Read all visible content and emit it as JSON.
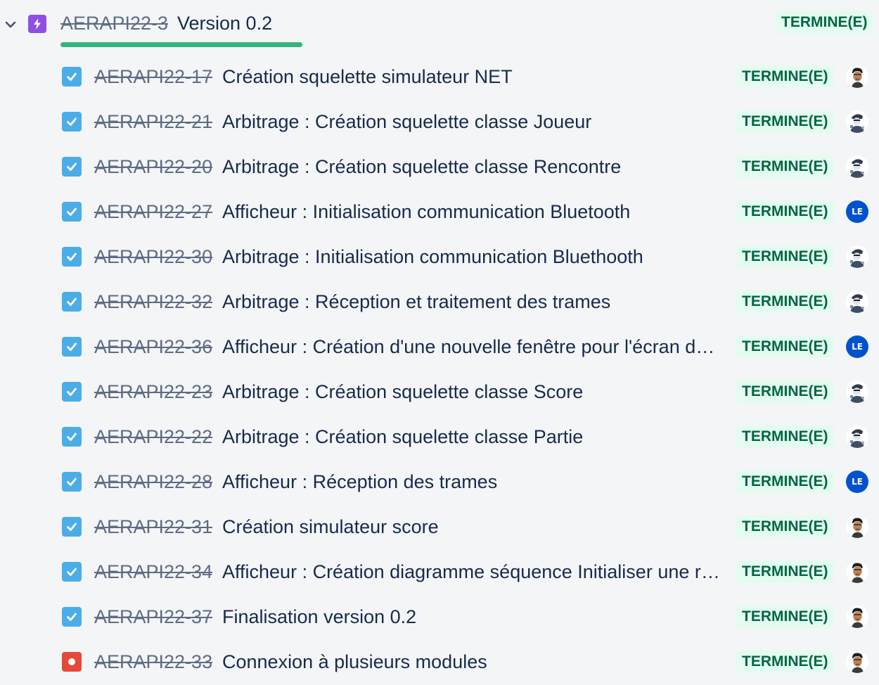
{
  "epic": {
    "key": "AERAPI22-3",
    "title": "Version 0.2",
    "status": "TERMINE(E)",
    "progress": 1.0,
    "icon": "epic-lightning-icon",
    "expand_icon": "chevron-down-icon",
    "colors": {
      "epic": "#904ee2",
      "progress": "#36b37e",
      "status_bg": "#e3fcef",
      "status_text": "#006644"
    }
  },
  "issue_types": {
    "task": {
      "icon": "checkbox-task-icon",
      "color": "#4bade8"
    },
    "bug": {
      "icon": "bug-dot-icon",
      "color": "#e5493a"
    }
  },
  "issues": [
    {
      "key": "AERAPI22-17",
      "summary": "Création squelette simulateur NET",
      "status": "TERMINE(E)",
      "type": "task",
      "assignee": {
        "kind": "photo-a",
        "icon": "user-avatar-portrait-icon"
      }
    },
    {
      "key": "AERAPI22-21",
      "summary": "Arbitrage : Création squelette classe Joueur",
      "status": "TERMINE(E)",
      "type": "task",
      "assignee": {
        "kind": "photo-b",
        "icon": "user-avatar-hacker-icon"
      }
    },
    {
      "key": "AERAPI22-20",
      "summary": "Arbitrage : Création squelette classe Rencontre",
      "status": "TERMINE(E)",
      "type": "task",
      "assignee": {
        "kind": "photo-b",
        "icon": "user-avatar-hacker-icon"
      }
    },
    {
      "key": "AERAPI22-27",
      "summary": "Afficheur : Initialisation communication Bluetooth",
      "status": "TERMINE(E)",
      "type": "task",
      "assignee": {
        "kind": "initials",
        "initials": "LE",
        "icon": "user-avatar-initials-icon"
      }
    },
    {
      "key": "AERAPI22-30",
      "summary": "Arbitrage : Initialisation communication Bluethooth",
      "status": "TERMINE(E)",
      "type": "task",
      "assignee": {
        "kind": "photo-b",
        "icon": "user-avatar-hacker-icon"
      }
    },
    {
      "key": "AERAPI22-32",
      "summary": "Arbitrage : Réception et traitement des trames",
      "status": "TERMINE(E)",
      "type": "task",
      "assignee": {
        "kind": "photo-b",
        "icon": "user-avatar-hacker-icon"
      }
    },
    {
      "key": "AERAPI22-36",
      "summary": "Afficheur : Création d'une nouvelle fenêtre pour l'écran d…",
      "status": "TERMINE(E)",
      "type": "task",
      "assignee": {
        "kind": "initials",
        "initials": "LE",
        "icon": "user-avatar-initials-icon"
      }
    },
    {
      "key": "AERAPI22-23",
      "summary": "Arbitrage : Création squelette classe Score",
      "status": "TERMINE(E)",
      "type": "task",
      "assignee": {
        "kind": "photo-b",
        "icon": "user-avatar-hacker-icon"
      }
    },
    {
      "key": "AERAPI22-22",
      "summary": "Arbitrage : Création squelette classe Partie",
      "status": "TERMINE(E)",
      "type": "task",
      "assignee": {
        "kind": "photo-b",
        "icon": "user-avatar-hacker-icon"
      }
    },
    {
      "key": "AERAPI22-28",
      "summary": "Afficheur : Réception des trames",
      "status": "TERMINE(E)",
      "type": "task",
      "assignee": {
        "kind": "initials",
        "initials": "LE",
        "icon": "user-avatar-initials-icon"
      }
    },
    {
      "key": "AERAPI22-31",
      "summary": "Création simulateur score",
      "status": "TERMINE(E)",
      "type": "task",
      "assignee": {
        "kind": "photo-a",
        "icon": "user-avatar-portrait-icon"
      }
    },
    {
      "key": "AERAPI22-34",
      "summary": "Afficheur : Création diagramme séquence Initialiser une r…",
      "status": "TERMINE(E)",
      "type": "task",
      "assignee": {
        "kind": "photo-a",
        "icon": "user-avatar-portrait-icon"
      }
    },
    {
      "key": "AERAPI22-37",
      "summary": "Finalisation version 0.2",
      "status": "TERMINE(E)",
      "type": "task",
      "assignee": {
        "kind": "photo-a",
        "icon": "user-avatar-portrait-icon"
      }
    },
    {
      "key": "AERAPI22-33",
      "summary": "Connexion à plusieurs modules",
      "status": "TERMINE(E)",
      "type": "bug",
      "assignee": {
        "kind": "photo-a",
        "icon": "user-avatar-portrait-icon"
      }
    }
  ]
}
